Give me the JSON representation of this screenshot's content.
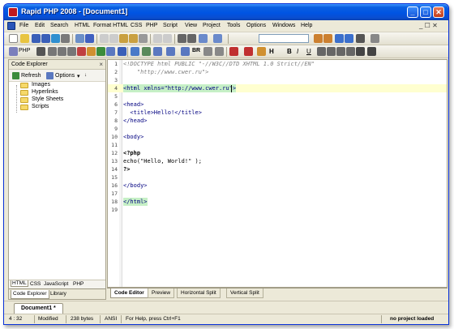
{
  "window": {
    "title": "Rapid PHP 2008 - [Document1]",
    "minimize": "_",
    "maximize": "□",
    "close": "✕"
  },
  "menu": {
    "items": [
      "File",
      "Edit",
      "Search",
      "HTML",
      "Format HTML",
      "CSS",
      "PHP",
      "Script",
      "View",
      "Project",
      "Tools",
      "Options",
      "Windows",
      "Help"
    ],
    "right": "_ ☐ ✕"
  },
  "toolbar2": {
    "php_label": "PHP",
    "br_label": "BR",
    "h_label": "H",
    "bold": "B",
    "italic": "I",
    "underline": "U"
  },
  "panel": {
    "title": "Code Explorer",
    "close": "×",
    "refresh": "Refresh",
    "options": "Options",
    "tree": [
      "Images",
      "Hyperlinks",
      "Style Sheets",
      "Scripts"
    ],
    "lang_tabs": [
      "HTML",
      "CSS",
      "JavaScript",
      "PHP"
    ],
    "bottom_tabs": [
      "Code Explorer",
      "Library"
    ]
  },
  "editor": {
    "lines": [
      {
        "n": "1",
        "text": "<!DOCTYPE html PUBLIC \"-//W3C//DTD XHTML 1.0 Strict//EN\""
      },
      {
        "n": "2",
        "text": "    \"http://www.cwer.ru\">"
      },
      {
        "n": "3",
        "text": ""
      },
      {
        "n": "4",
        "text": "<html xmlns=\"http://www.cwer.ru\">"
      },
      {
        "n": "5",
        "text": ""
      },
      {
        "n": "6",
        "text": "<head>"
      },
      {
        "n": "7",
        "text": "  <title>Hello!</title>"
      },
      {
        "n": "8",
        "text": "</head>"
      },
      {
        "n": "9",
        "text": ""
      },
      {
        "n": "10",
        "text": "<body>"
      },
      {
        "n": "11",
        "text": ""
      },
      {
        "n": "12",
        "text": "<?php"
      },
      {
        "n": "13",
        "text": "echo(\"Hello, World!\" );"
      },
      {
        "n": "14",
        "text": "?>"
      },
      {
        "n": "15",
        "text": ""
      },
      {
        "n": "16",
        "text": "</body>"
      },
      {
        "n": "17",
        "text": ""
      },
      {
        "n": "18",
        "text": "</html>"
      },
      {
        "n": "19",
        "text": ""
      }
    ],
    "tabs": [
      "Code Editor",
      "Preview",
      "Horizontal Split",
      "Vertical Split"
    ]
  },
  "documents": {
    "tab": "Document1 *"
  },
  "status": {
    "position": "4 : 32",
    "modified": "Modified",
    "size": "238 bytes",
    "encoding": "ANSI",
    "help": "For Help, press Ctrl+F1",
    "project": "no project loaded"
  }
}
